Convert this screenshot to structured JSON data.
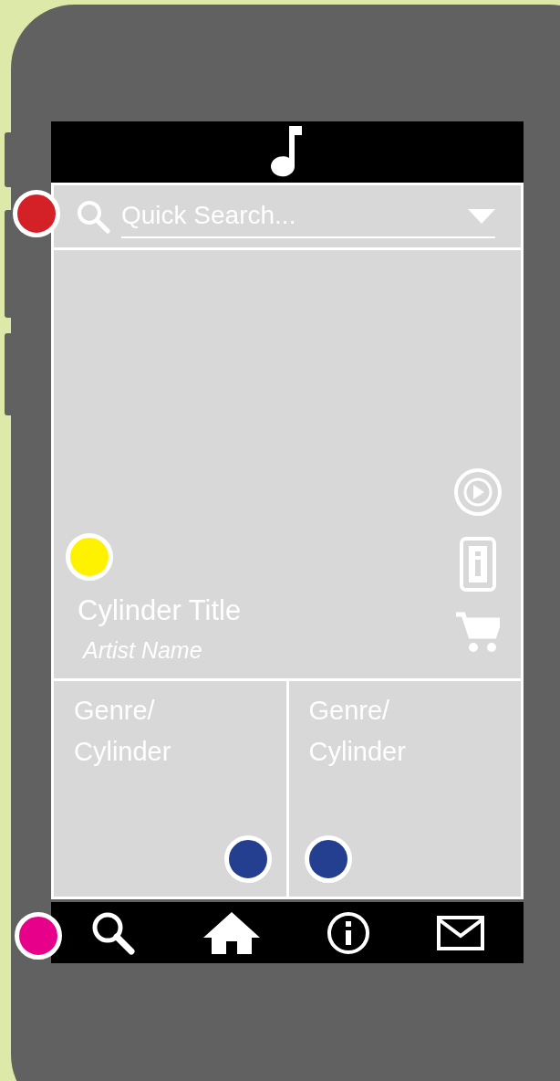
{
  "search": {
    "placeholder": "Quick Search..."
  },
  "featured": {
    "title": "Cylinder Title",
    "artist": "Artist Name"
  },
  "tiles": [
    {
      "label": "Genre/\nCylinder"
    },
    {
      "label": "Genre/\nCylinder"
    }
  ],
  "nav": [
    {
      "kind": "search"
    },
    {
      "kind": "home"
    },
    {
      "kind": "info"
    },
    {
      "kind": "mail"
    }
  ],
  "markers": [
    {
      "color": "#d42127"
    },
    {
      "color": "#fff200"
    },
    {
      "color": "#243f8f"
    },
    {
      "color": "#243f8f"
    },
    {
      "color": "#e6008a"
    }
  ]
}
